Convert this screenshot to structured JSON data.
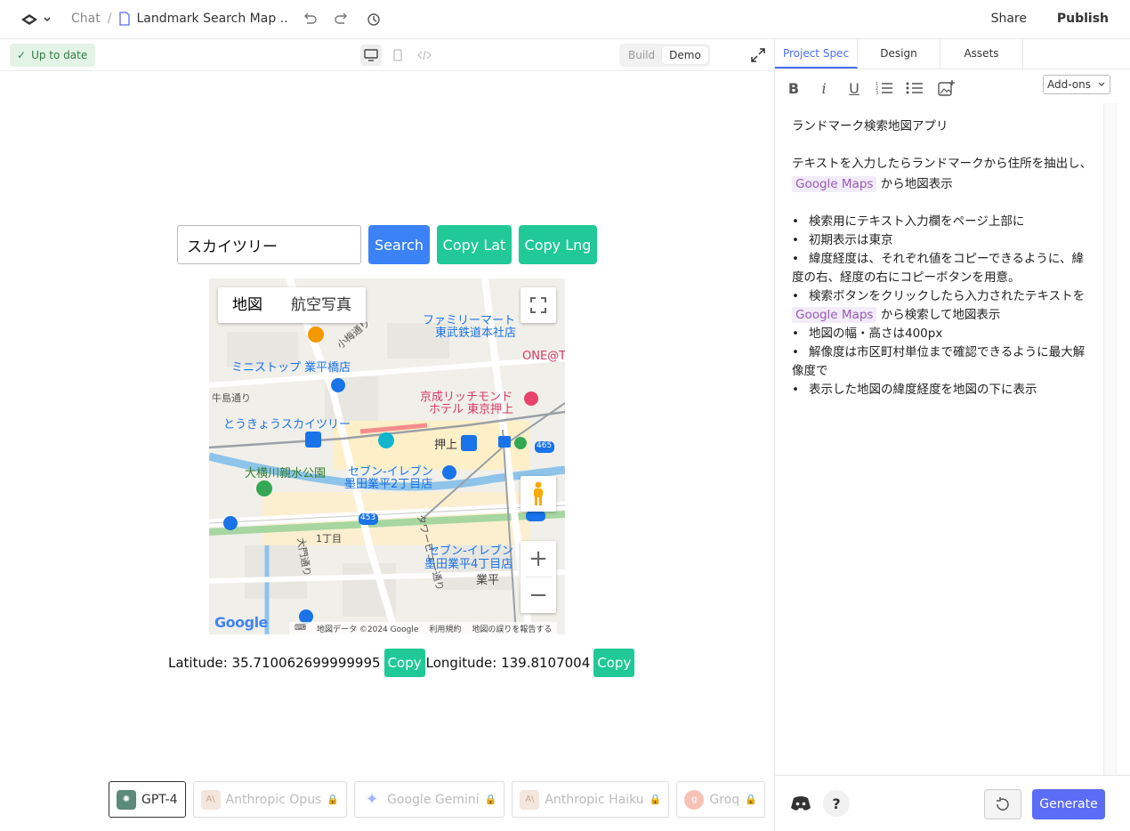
{
  "header": {
    "chat_label": "Chat",
    "separator": "/",
    "doc_title": "Landmark Search Map ...",
    "share_label": "Share",
    "publish_label": "Publish"
  },
  "preview_bar": {
    "status": "Up to date",
    "mode_build": "Build",
    "mode_demo": "Demo",
    "active_mode": "Demo"
  },
  "app": {
    "search_value": "スカイツリー",
    "search_button": "Search",
    "copy_lat_button": "Copy Lat",
    "copy_lng_button": "Copy Lng",
    "map": {
      "type_map": "地図",
      "type_satellite": "航空写真",
      "zoom_in": "+",
      "zoom_out": "−",
      "logo": "Google",
      "attribution": "地図データ ©2024 Google",
      "terms": "利用規約",
      "report": "地図の誤りを報告する",
      "labels": {
        "familymart": "ファミリーマート",
        "tobu": "東武鉄道本社店",
        "ministop": "ミニストップ 業平橋店",
        "keisei1": "京成リッチモンド",
        "keisei2": "ホテル 東京押上",
        "skytree": "とうきょうスカイツリー",
        "oshiage": "押上",
        "park": "大横川親水公園",
        "seven1a": "セブン-イレブン",
        "seven1b": "墨田業平2丁目店",
        "seven2a": "セブン-イレブン",
        "seven2b": "墨田業平4丁目店",
        "chome": "1丁目",
        "narihira": "業平",
        "one": "ONE@T",
        "road1": "小梅通り",
        "road2": "タワービュー通り",
        "road3": "大門通り",
        "road4": "牛島通り",
        "r465": "465",
        "r453": "453"
      }
    },
    "latitude_label": "Latitude: 35.710062699999995",
    "longitude_label": "Longitude: 139.8107004",
    "copy_label": "Copy"
  },
  "models": [
    {
      "name": "GPT-4",
      "active": true
    },
    {
      "name": "Anthropic Opus",
      "active": false
    },
    {
      "name": "Google Gemini",
      "active": false
    },
    {
      "name": "Anthropic Haiku",
      "active": false
    },
    {
      "name": "Groq",
      "active": false
    }
  ],
  "panel": {
    "tabs": [
      "Project Spec",
      "Design",
      "Assets"
    ],
    "active_tab": "Project Spec",
    "addons_label": "Add-ons",
    "generate_label": "Generate",
    "help_label": "?",
    "spec": {
      "title": "ランドマーク検索地図アプリ",
      "intro1": "テキストを入力したらランドマークから住所を抽出し、",
      "intro_tag": "Google Maps",
      "intro2": "から地図表示",
      "items": [
        "検索用にテキスト入力欄をページ上部に",
        "初期表示は東京",
        "緯度経度は、それぞれ値をコピーできるように、緯度の右、経度の右にコピーボタンを用意。",
        "検索ボタンをクリックしたら入力されたテキストを",
        "地図の幅・高さは400px",
        "解像度は市区町村単位まで確認できるように最大解像度で",
        "表示した地図の緯度経度を地図の下に表示"
      ],
      "item4_tag": "Google Maps",
      "item4_tail": "から検索して地図表示"
    }
  },
  "colors": {
    "accent": "#4a6cf7",
    "search_button": "#3b82f6",
    "copy_button": "#20c997",
    "generate": "#5b6cf6"
  }
}
